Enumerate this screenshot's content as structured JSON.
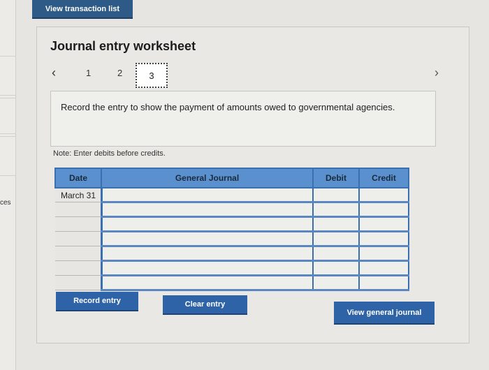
{
  "sidebar": {
    "partial_label": "ces"
  },
  "header": {
    "view_transactions_label": "View transaction list"
  },
  "worksheet": {
    "title": "Journal entry worksheet",
    "pager": {
      "pages": [
        "1",
        "2",
        "3"
      ],
      "current": "3"
    },
    "instruction": "Record the entry to show the payment of amounts owed to governmental agencies.",
    "note": "Note: Enter debits before credits."
  },
  "table": {
    "columns": [
      "Date",
      "General Journal",
      "Debit",
      "Credit"
    ],
    "rows": [
      {
        "date": "March 31",
        "account": "",
        "debit": "",
        "credit": ""
      },
      {
        "date": "",
        "account": "",
        "debit": "",
        "credit": ""
      },
      {
        "date": "",
        "account": "",
        "debit": "",
        "credit": ""
      },
      {
        "date": "",
        "account": "",
        "debit": "",
        "credit": ""
      },
      {
        "date": "",
        "account": "",
        "debit": "",
        "credit": ""
      },
      {
        "date": "",
        "account": "",
        "debit": "",
        "credit": ""
      },
      {
        "date": "",
        "account": "",
        "debit": "",
        "credit": ""
      }
    ]
  },
  "buttons": {
    "record": "Record entry",
    "clear": "Clear entry",
    "view_general_journal": "View general journal"
  },
  "icons": {
    "prev": "chevron-left-icon",
    "next": "chevron-right-icon"
  }
}
